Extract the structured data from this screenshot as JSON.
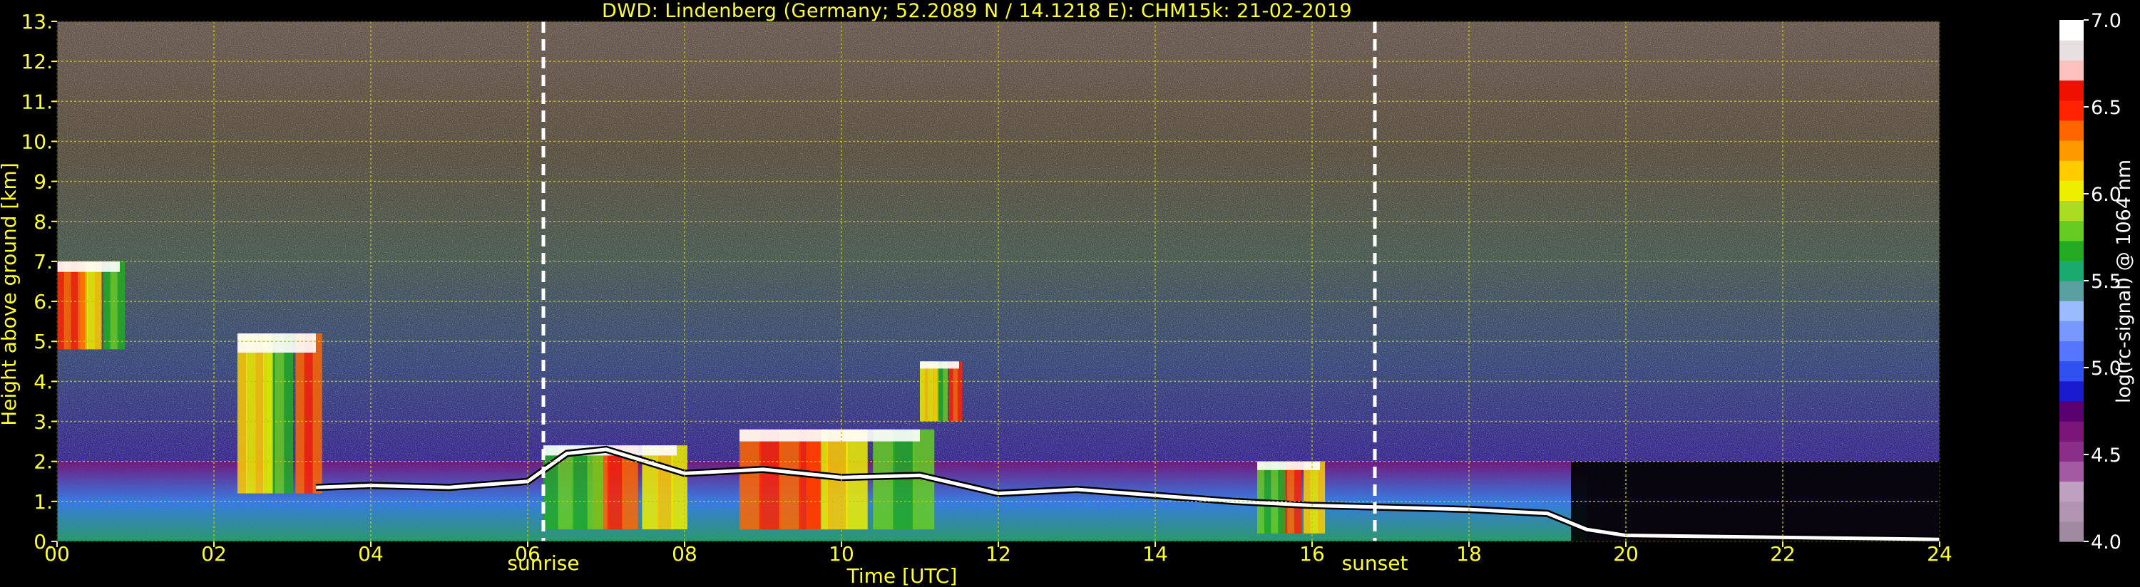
{
  "title": "DWD: Lindenberg (Germany; 52.2089 N / 14.1218 E):    CHM15k: 21-02-2019",
  "colors": {
    "background": "#000000",
    "text": "#ffff33",
    "grid": "#c8c800",
    "marker": "#ffffff"
  },
  "chart_data": [
    {
      "type": "heatmap",
      "title": "DWD: Lindenberg (Germany; 52.2089 N / 14.1218 E):    CHM15k: 21-02-2019",
      "xlabel": "Time [UTC]",
      "ylabel": "Height above ground [km]",
      "xlim": [
        0,
        24
      ],
      "ylim": [
        0,
        13
      ],
      "x_ticks": [
        0,
        2,
        4,
        6,
        8,
        10,
        12,
        14,
        16,
        18,
        20,
        22,
        24
      ],
      "x_tick_labels": [
        "00",
        "02",
        "04",
        "06",
        "08",
        "10",
        "12",
        "14",
        "16",
        "18",
        "20",
        "22",
        "24"
      ],
      "y_ticks": [
        0,
        1,
        2,
        3,
        4,
        5,
        6,
        7,
        8,
        9,
        10,
        11,
        12,
        13
      ],
      "y_tick_labels": [
        "0.",
        "1.",
        "2.",
        "3.",
        "4.",
        "5.",
        "6.",
        "7.",
        "8.",
        "9.",
        "10.",
        "11.",
        "12.",
        "13."
      ],
      "grid": true,
      "annotations": [
        {
          "label": "sunrise",
          "x": 6.2
        },
        {
          "label": "sunset",
          "x": 16.8
        }
      ],
      "colorbar": {
        "label": "log(rc-signal) @ 1064 nm",
        "range": [
          4.0,
          7.0
        ],
        "ticks": [
          4.0,
          4.5,
          5.0,
          5.5,
          6.0,
          6.5,
          7.0
        ],
        "tick_labels": [
          "4.0",
          "4.5",
          "5.0",
          "5.5",
          "6.0",
          "6.5",
          "7.0"
        ],
        "palette": [
          "#a08aa0",
          "#b295b2",
          "#c0a0c0",
          "#a35aa3",
          "#8a2e8a",
          "#7a157a",
          "#5a0070",
          "#1a1ad0",
          "#3050f0",
          "#5577ff",
          "#7799ff",
          "#99bbff",
          "#5aa0a0",
          "#1aaa70",
          "#22aa22",
          "#66cc22",
          "#aadd22",
          "#eeee00",
          "#ffcc00",
          "#ff9900",
          "#ff6600",
          "#ff2200",
          "#ee1100",
          "#ffc0c0",
          "#e8e0e0",
          "#ffffff"
        ]
      },
      "features": [
        {
          "kind": "cloud_top_line",
          "points": [
            [
              3.3,
              1.35
            ],
            [
              4.0,
              1.4
            ],
            [
              5.0,
              1.35
            ],
            [
              6.0,
              1.5
            ],
            [
              6.5,
              2.2
            ],
            [
              7.0,
              2.3
            ],
            [
              8.0,
              1.7
            ],
            [
              9.0,
              1.8
            ],
            [
              10.0,
              1.6
            ],
            [
              11.0,
              1.65
            ],
            [
              12.0,
              1.2
            ],
            [
              13.0,
              1.3
            ],
            [
              14.0,
              1.15
            ],
            [
              15.0,
              1.0
            ],
            [
              16.0,
              0.9
            ],
            [
              17.0,
              0.85
            ],
            [
              18.0,
              0.8
            ],
            [
              19.0,
              0.7
            ],
            [
              19.5,
              0.3
            ],
            [
              20.0,
              0.15
            ],
            [
              24.0,
              0.05
            ]
          ]
        },
        {
          "kind": "cloud_patch",
          "x": [
            0.0,
            0.8
          ],
          "y": [
            4.8,
            7.0
          ]
        },
        {
          "kind": "cloud_patch",
          "x": [
            2.3,
            3.3
          ],
          "y": [
            1.2,
            5.2
          ]
        },
        {
          "kind": "cloud_patch",
          "x": [
            6.2,
            7.9
          ],
          "y": [
            0.3,
            2.4
          ]
        },
        {
          "kind": "cloud_patch",
          "x": [
            8.7,
            11.0
          ],
          "y": [
            0.3,
            2.8
          ]
        },
        {
          "kind": "cloud_patch",
          "x": [
            11.0,
            11.5
          ],
          "y": [
            3.0,
            4.5
          ]
        },
        {
          "kind": "cloud_patch",
          "x": [
            15.3,
            16.1
          ],
          "y": [
            0.2,
            2.0
          ]
        }
      ]
    }
  ]
}
